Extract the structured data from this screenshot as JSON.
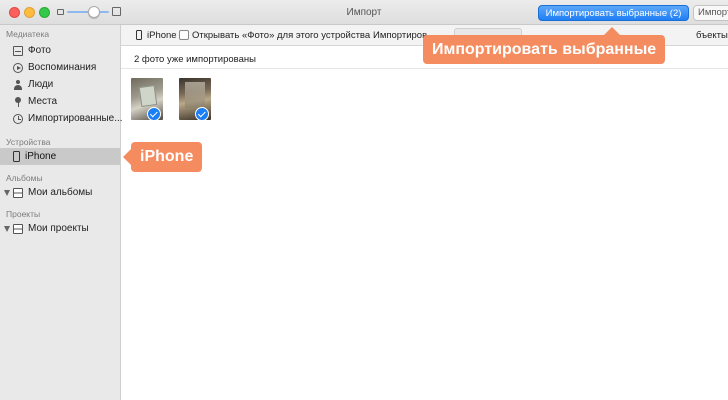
{
  "window": {
    "title": "Импорт",
    "import_selected_button": "Импортировать выбранные (2)",
    "import_all_button": "Импортировать все"
  },
  "sidebar": {
    "library_header": "Медиатека",
    "library_items": [
      {
        "label": "Фото",
        "icon": "photos-icon"
      },
      {
        "label": "Воспоминания",
        "icon": "memories-icon"
      },
      {
        "label": "Люди",
        "icon": "people-icon"
      },
      {
        "label": "Места",
        "icon": "places-icon"
      },
      {
        "label": "Импортированные...",
        "icon": "imported-icon"
      }
    ],
    "devices_header": "Устройства",
    "device_item": {
      "label": "iPhone",
      "icon": "iphone-icon",
      "selected": true
    },
    "albums_header": "Альбомы",
    "albums_item": {
      "label": "Мои альбомы",
      "icon": "album-icon"
    },
    "projects_header": "Проекты",
    "projects_item": {
      "label": "Мои проекты",
      "icon": "album-icon"
    }
  },
  "toolbar": {
    "device_label": "iPhone",
    "open_photos_label": "Открывать «Фото» для этого устройства",
    "open_photos_checked": false,
    "import_to_label": "Импортиров",
    "right_label": "бъекты"
  },
  "content": {
    "status": "2 фото уже импортированы",
    "thumbnails": [
      {
        "selected": true
      },
      {
        "selected": true
      }
    ]
  },
  "callouts": {
    "import_selected": "Импортировать выбранные",
    "iphone": "iPhone"
  },
  "colors": {
    "accent_blue": "#1a7ef4",
    "callout_orange": "#f58c60",
    "sidebar_bg": "#e9e9ea"
  }
}
